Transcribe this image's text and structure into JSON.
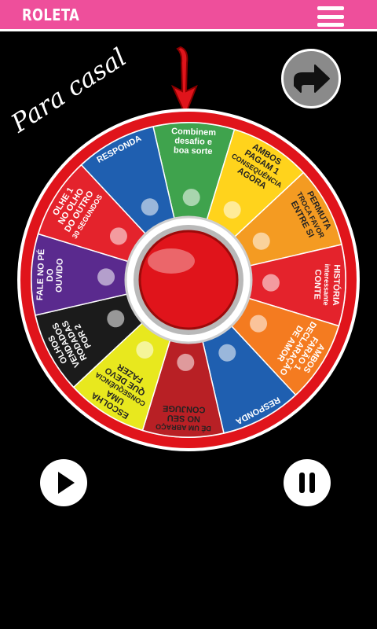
{
  "app": {
    "title": "ROLETA",
    "tagline": "Para casal"
  },
  "wheel": {
    "segments": [
      {
        "lines": [
          "Combinem",
          "desafio e",
          "boa sorte"
        ],
        "color": "#3fa34d",
        "text_color": "#ffffff",
        "icon": "trophy-icon"
      },
      {
        "lines": [
          "AMBOS",
          "PAGAM 1",
          "CONSEQUÊNCIA",
          "AGORA"
        ],
        "color": "#ffd31c",
        "text_color": "#222222",
        "icon": "person-icon"
      },
      {
        "lines": [
          "PERMUTA",
          "TROCA FAVOR",
          "ENTRE SI"
        ],
        "color": "#f49b22",
        "text_color": "#222222",
        "icon": "handshake-icon"
      },
      {
        "lines": [
          "HISTÓRIA",
          "interessante",
          "CONTE"
        ],
        "color": "#e4232c",
        "text_color": "#ffffff",
        "icon": "book-icon"
      },
      {
        "lines": [
          "AMBOS",
          "FARÃO 1",
          "DECLARAÇÃO",
          "DE AMOR"
        ],
        "color": "#f47b20",
        "text_color": "#ffffff",
        "icon": "heart-icon"
      },
      {
        "lines": [
          "RESPONDA"
        ],
        "color": "#1f5fb0",
        "text_color": "#ffffff",
        "icon": "question-icon"
      },
      {
        "lines": [
          "DÊ UM ABRAÇO",
          "NO SEU",
          "CONJUGE"
        ],
        "color": "#b82025",
        "text_color": "#222222",
        "icon": "hug-icon"
      },
      {
        "lines": [
          "ESCOLHA",
          "UMA",
          "CONSEQUÊNCIA",
          "QUE DEVO",
          "FAZER"
        ],
        "color": "#e8e81e",
        "text_color": "#222222",
        "icon": "broom-icon"
      },
      {
        "lines": [
          "OLHOS",
          "VENDADOS",
          "RODADAS",
          "POR 2"
        ],
        "color": "#1b1b1b",
        "text_color": "#ffffff",
        "icon": "blindfold-icon"
      },
      {
        "lines": [
          "FALE NO PÉ",
          "DO",
          "OUVIDO"
        ],
        "color": "#5a2a8e",
        "text_color": "#ffffff",
        "icon": "ear-icon"
      },
      {
        "lines": [
          "OLHE 1",
          "NO OLHO",
          "DO OUTRO",
          "30 SEGUNDOS"
        ],
        "color": "#e4232c",
        "text_color": "#ffffff",
        "icon": "eye-icon"
      },
      {
        "lines": [
          "RESPONDA"
        ],
        "color": "#1f5fb0",
        "text_color": "#ffffff",
        "icon": "question-icon"
      }
    ]
  },
  "controls": {
    "share_icon": "share-icon",
    "play_icon": "play-icon",
    "pause_icon": "pause-icon",
    "menu_icon": "menu-icon"
  },
  "colors": {
    "appbar": "#ee4f9b",
    "wheel_rim": "#e0141b",
    "center_button": "#e0141b",
    "arrow": "#e0141b"
  }
}
